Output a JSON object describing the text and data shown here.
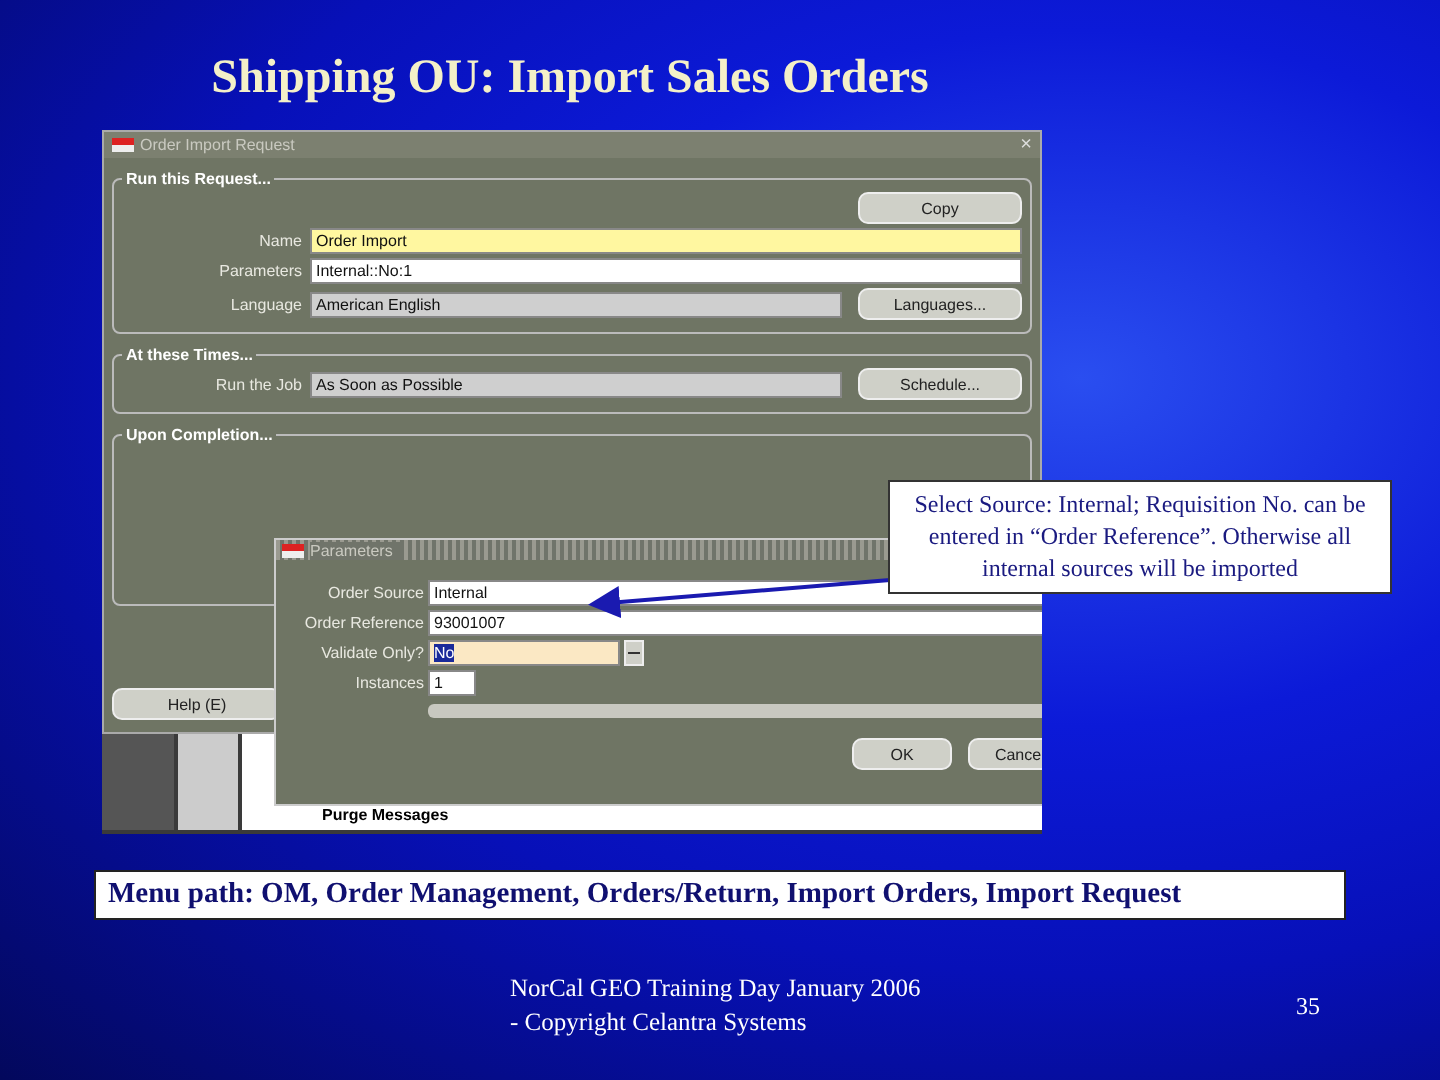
{
  "slide": {
    "title": "Shipping OU: Import Sales Orders",
    "page_number": "35",
    "footer": "NorCal GEO Training Day January 2006 -  Copyright Celantra Systems"
  },
  "request_window": {
    "title": "Order Import Request",
    "close": "×",
    "run_section": {
      "heading": "Run this Request...",
      "copy_button": "Copy",
      "languages_button": "Languages...",
      "fields": [
        {
          "label": "Name",
          "value": "Order Import",
          "kind": "required"
        },
        {
          "label": "Parameters",
          "value": "Internal::No:1",
          "kind": "editable"
        },
        {
          "label": "Language",
          "value": "American English",
          "kind": "readonly"
        }
      ]
    },
    "times_section": {
      "heading": "At these Times...",
      "schedule_button": "Schedule...",
      "fields": [
        {
          "label": "Run the Job",
          "value": "As Soon as Possible",
          "kind": "readonly"
        }
      ]
    },
    "completion_section": {
      "heading": "Upon Completion..."
    },
    "help_button": "Help (E)"
  },
  "background_panel": {
    "text": "Purge Messages"
  },
  "parameters_dialog": {
    "title": "Parameters",
    "fields": [
      {
        "label": "Order Source",
        "value": "Internal",
        "kind": "text"
      },
      {
        "label": "Order Reference",
        "value": "93001007",
        "kind": "text"
      },
      {
        "label": "Validate Only?",
        "value": "No",
        "kind": "list"
      },
      {
        "label": "Instances",
        "value": "1",
        "kind": "short"
      }
    ],
    "buttons": [
      "OK",
      "Cance"
    ]
  },
  "callout": {
    "text": "Select Source: Internal; Requisition No. can be entered in “Order Reference”. Otherwise all internal sources will be imported"
  },
  "menu_path": {
    "text": "Menu path: OM, Order Management, Orders/Return, Import Orders, Import Request"
  }
}
